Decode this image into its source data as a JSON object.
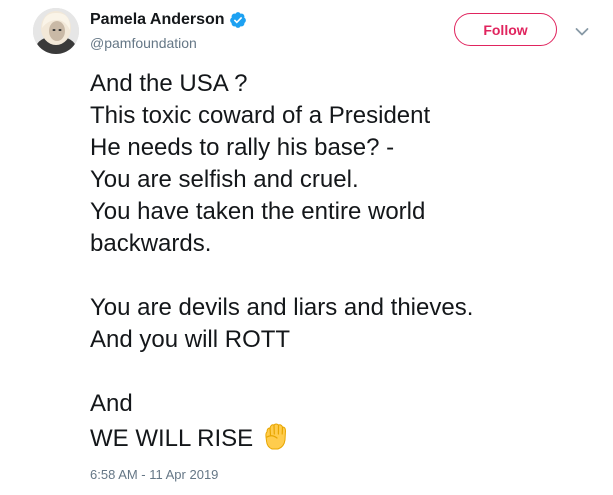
{
  "tweet": {
    "author": {
      "name": "Pamela Anderson",
      "handle": "@pamfoundation",
      "verified": true
    },
    "follow_label": "Follow",
    "lines": [
      "And the USA ?",
      "This toxic coward of a President",
      "He needs to rally his base? -",
      "You are selfish and cruel.",
      "You have taken the entire world",
      "backwards.",
      "",
      "You are devils and liars and thieves.",
      "And you will ROTT",
      "",
      "And",
      "WE WILL RISE"
    ],
    "timestamp": "6:58 AM - 11 Apr 2019"
  },
  "icons": {
    "avatar": "profile-photo",
    "verified": "verified-badge-icon",
    "menu": "chevron-down-icon",
    "emoji": "raised-fist-emoji"
  },
  "colors": {
    "accent": "#e0245e",
    "verified": "#1da1f2",
    "secondary_text": "#657786",
    "text": "#14171a"
  }
}
